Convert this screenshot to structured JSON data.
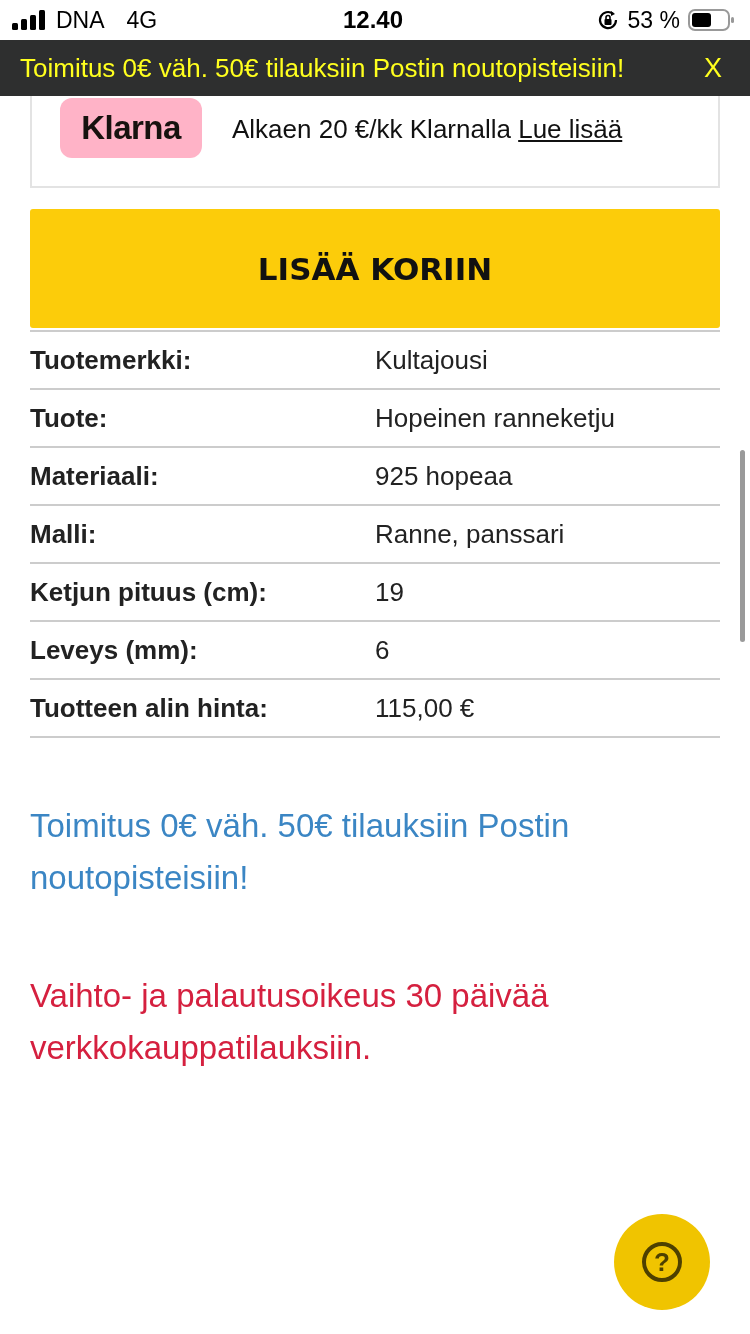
{
  "status_bar": {
    "carrier": "DNA",
    "network": "4G",
    "time": "12.40",
    "battery": "53 %"
  },
  "banner": {
    "text": "Toimitus 0€ väh. 50€ tilauksiin Postin noutopisteisiin!",
    "close": "X"
  },
  "klarna": {
    "logo": "Klarna",
    "text": "Alkaen 20 €/kk Klarnalla",
    "link": "Lue lisää"
  },
  "add_to_cart": "LISÄÄ KORIIN",
  "specs": [
    {
      "label": "Tuotemerkki:",
      "value": "Kultajousi"
    },
    {
      "label": "Tuote:",
      "value": "Hopeinen ranneketju"
    },
    {
      "label": "Materiaali:",
      "value": "925 hopeaa"
    },
    {
      "label": "Malli:",
      "value": "Ranne, panssari"
    },
    {
      "label": "Ketjun pituus (cm):",
      "value": "19"
    },
    {
      "label": "Leveys (mm):",
      "value": "6"
    },
    {
      "label": "Tuotteen alin hinta:",
      "value": "115,00 €"
    }
  ],
  "notices": [
    {
      "kind": "shipping",
      "text": "Toimitus 0€ väh. 50€ tilauksiin Postin noutopisteisiin!"
    },
    {
      "kind": "returns",
      "text": "Vaihto- ja palautusoikeus 30 päivää verkkokauppatilauksiin."
    }
  ],
  "help_button": {
    "icon": "?"
  }
}
